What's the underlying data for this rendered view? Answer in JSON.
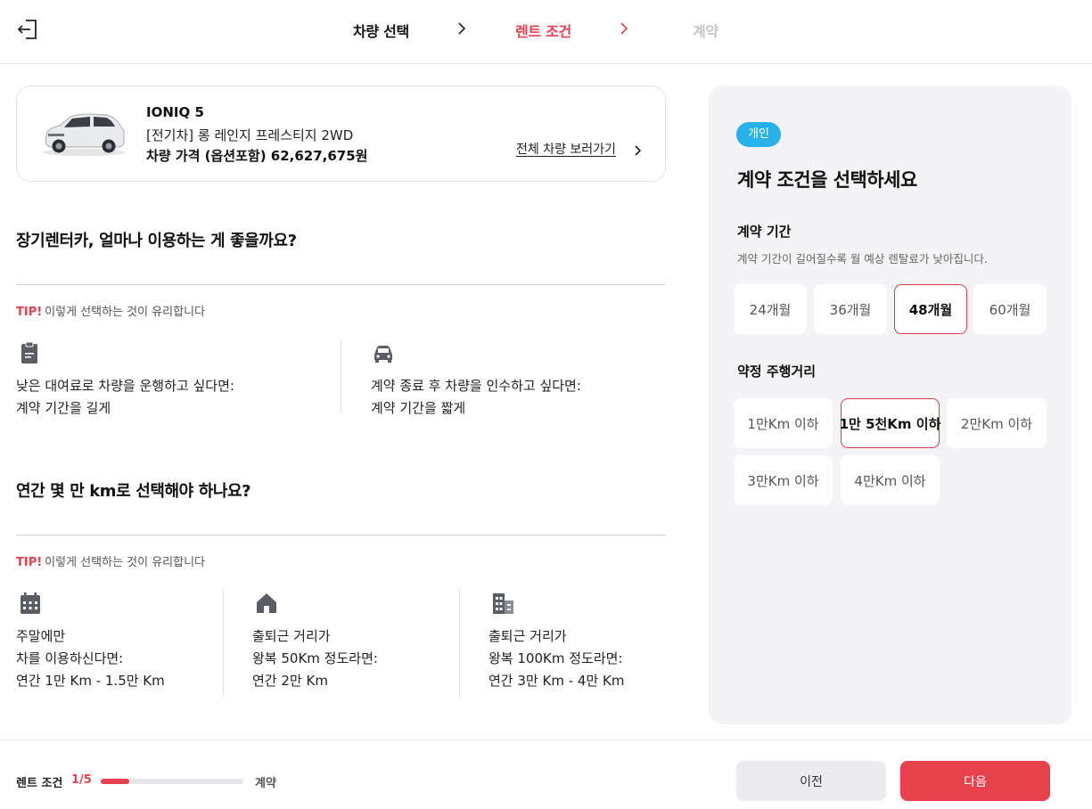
{
  "header": {
    "steps": [
      "차량 선택",
      "렌트 조건",
      "계약"
    ],
    "active_step": 1
  },
  "car": {
    "name": "IONIQ 5",
    "trim": "[전기차] 롱 레인지 프레스티지 2WD",
    "price": "차량 가격 (옵션포함) 62,627,675원",
    "view_all_label": "전체 차량 보러가기"
  },
  "period_section": {
    "question": "장기렌터카, 얼마나 이용하는 게 좋을까요?",
    "tip_label": "TIP!",
    "tip_text": "이렇게 선택하는 것이 유리합니다",
    "items": [
      {
        "icon": "clipboard-icon",
        "line1": "낮은 대여료로 차량을 운행하고 싶다면:",
        "line2": "계약 기간을 길게"
      },
      {
        "icon": "car-icon",
        "line1": "계약 종료 후 차량을 인수하고 싶다면:",
        "line2": "계약 기간을 짧게"
      }
    ]
  },
  "mileage_section": {
    "question": "연간 몇 만 km로 선택해야 하나요?",
    "tip_label": "TIP!",
    "tip_text": "이렇게 선택하는 것이 유리합니다",
    "items": [
      {
        "icon": "calendar-icon",
        "line1": "주말에만",
        "line2": "차를 이용하신다면:",
        "line3": "연간 1만 Km - 1.5만 Km"
      },
      {
        "icon": "house-icon",
        "line1": "출퇴근 거리가",
        "line2": "왕복 50Km 정도라면:",
        "line3": "연간 2만 Km"
      },
      {
        "icon": "building-icon",
        "line1": "출퇴근 거리가",
        "line2": "왕복 100Km 정도라면:",
        "line3": "연간 3만 Km - 4만 Km"
      }
    ]
  },
  "panel": {
    "badge": "개인",
    "title": "계약 조건을 선택하세요",
    "period_label": "계약 기간",
    "period_desc": "계약 기간이 길어질수록 월 예상 렌탈료가 낮아집니다.",
    "period_options": [
      "24개월",
      "36개월",
      "48개월",
      "60개월"
    ],
    "period_selected": "48개월",
    "mileage_label": "약정 주행거리",
    "mileage_options": [
      "1만Km 이하",
      "1만 5천Km 이하",
      "2만Km 이하",
      "3만Km 이하",
      "4만Km 이하"
    ],
    "mileage_selected": "1만 5천Km 이하"
  },
  "footer": {
    "progress_label": "렌트 조건",
    "progress_count": "1/5",
    "progress_fraction": 0.2,
    "progress_end_label": "계약",
    "prev_label": "이전",
    "next_label": "다음"
  },
  "colors": {
    "accent": "#e8404c",
    "badge": "#27b3ea",
    "panel_bg": "#f4f4f6"
  }
}
